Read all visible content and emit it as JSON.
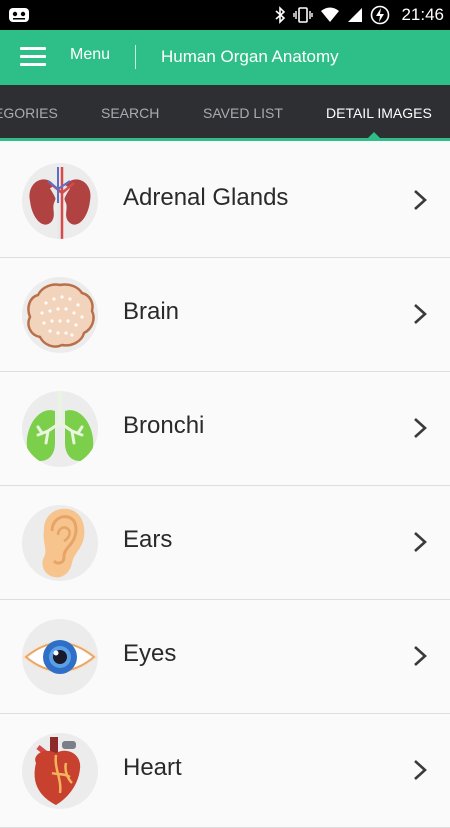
{
  "status_bar": {
    "time": "21:46",
    "icons": [
      "notification-icon",
      "bluetooth-icon",
      "vibrate-icon",
      "wifi-icon",
      "signal-icon",
      "battery-charging-icon"
    ]
  },
  "app_bar": {
    "menu_label": "Menu",
    "title": "Human Organ Anatomy",
    "color": "#2ebf88"
  },
  "tabs": [
    {
      "label": "EGORIES",
      "active": false
    },
    {
      "label": "SEARCH",
      "active": false
    },
    {
      "label": "SAVED LIST",
      "active": false
    },
    {
      "label": "DETAIL IMAGES",
      "active": true
    }
  ],
  "organs": [
    {
      "name": "Adrenal Glands",
      "icon": "kidney-icon"
    },
    {
      "name": "Brain",
      "icon": "brain-icon"
    },
    {
      "name": "Bronchi",
      "icon": "lungs-icon"
    },
    {
      "name": "Ears",
      "icon": "ear-icon"
    },
    {
      "name": "Eyes",
      "icon": "eye-icon"
    },
    {
      "name": "Heart",
      "icon": "heart-icon"
    }
  ]
}
